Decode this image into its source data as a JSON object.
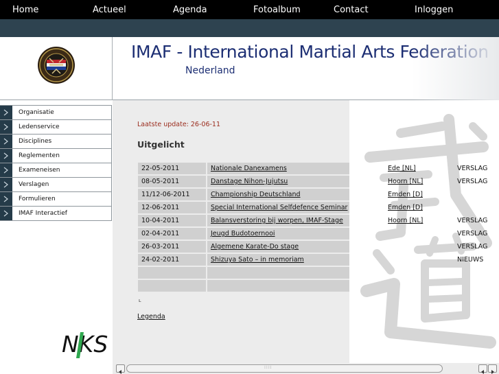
{
  "nav": {
    "items": [
      "Home",
      "Actueel",
      "Agenda",
      "Fotoalbum",
      "Contact",
      "Inloggen"
    ]
  },
  "header": {
    "title": "IMAF - International Martial Arts Federation",
    "subtitle": "Nederland"
  },
  "sidebar": {
    "items": [
      {
        "label": "Organisatie"
      },
      {
        "label": "Ledenservice"
      },
      {
        "label": "Disciplines"
      },
      {
        "label": "Reglementen"
      },
      {
        "label": "Exameneisen"
      },
      {
        "label": "Verslagen"
      },
      {
        "label": "Formulieren"
      },
      {
        "label": "IMAF Interactief"
      }
    ],
    "sponsor_logo_text": "NKS"
  },
  "content": {
    "last_update": "Laatste update: 26-06-11",
    "featured_title": "Uitgelicht",
    "rows": [
      {
        "date": "22-05-2011",
        "title": "Nationale Danexamens",
        "location": "Ede [NL]",
        "type": "VERSLAG"
      },
      {
        "date": "08-05-2011",
        "title": "Danstage Nihon-Jujutsu",
        "location": "Hoorn [NL]",
        "type": "VERSLAG"
      },
      {
        "date": "11/12-06-2011",
        "title": "Championship Deutschland",
        "location": "Emden [D]",
        "type": ""
      },
      {
        "date": "12-06-2011",
        "title": "Special International Selfdefence Seminar",
        "location": "Emden [D]",
        "type": ""
      },
      {
        "date": "10-04-2011",
        "title": "Balansverstoring bij worpen, IMAF-Stage",
        "location": "Hoorn [NL]",
        "type": "VERSLAG"
      },
      {
        "date": "02-04-2011",
        "title": "Jeugd Budotoernooi",
        "location": "",
        "type": "VERSLAG"
      },
      {
        "date": "26-03-2011",
        "title": "Algemene Karate-Do stage",
        "location": "",
        "type": "VERSLAG"
      },
      {
        "date": "24-02-2011",
        "title": "Shizuya Sato – in memoriam",
        "location": "",
        "type": "NIEUWS"
      },
      {
        "date": "",
        "title": "",
        "location": "",
        "type": ""
      },
      {
        "date": "",
        "title": "",
        "location": "",
        "type": ""
      }
    ],
    "small_mark": "ʟ",
    "legend_link": "Legenda"
  },
  "colors": {
    "nav_bg": "#000000",
    "subbar_bg": "#2e4350",
    "title_blue": "#1c2e73",
    "update_red": "#9a2b1c",
    "menu_arrow_bg": "#253b49"
  }
}
